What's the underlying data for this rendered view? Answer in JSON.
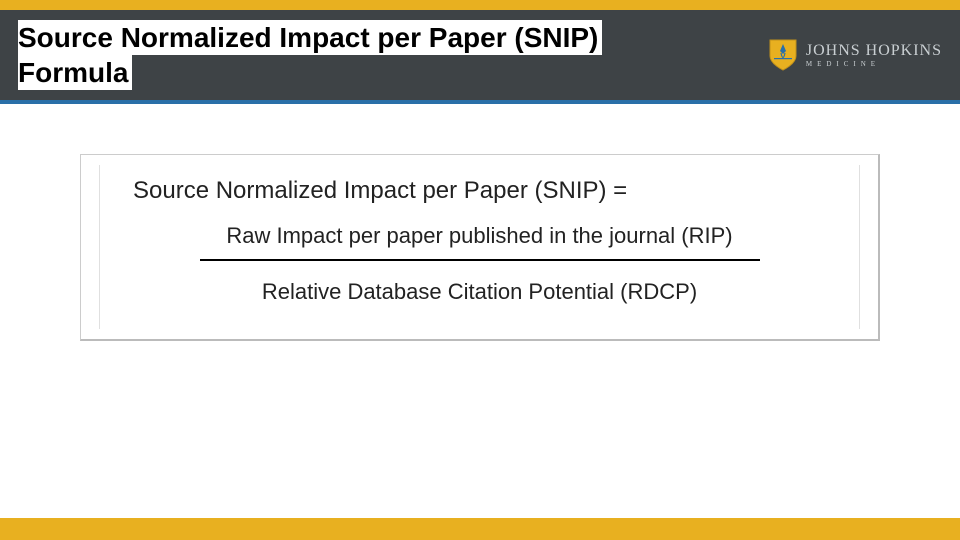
{
  "header": {
    "title_line1": "Source Normalized Impact per Paper (SNIP)",
    "title_line2": "Formula"
  },
  "logo": {
    "main": "JOHNS HOPKINS",
    "sub": "MEDICINE"
  },
  "formula": {
    "lhs": "Source Normalized Impact per Paper (SNIP) =",
    "numerator": "Raw Impact per paper published in the journal (RIP)",
    "denominator": "Relative Database Citation Potential (RDCP)"
  },
  "colors": {
    "accent_yellow": "#e8b020",
    "header_bg": "#3e4346",
    "header_rule": "#2a6fa8"
  }
}
